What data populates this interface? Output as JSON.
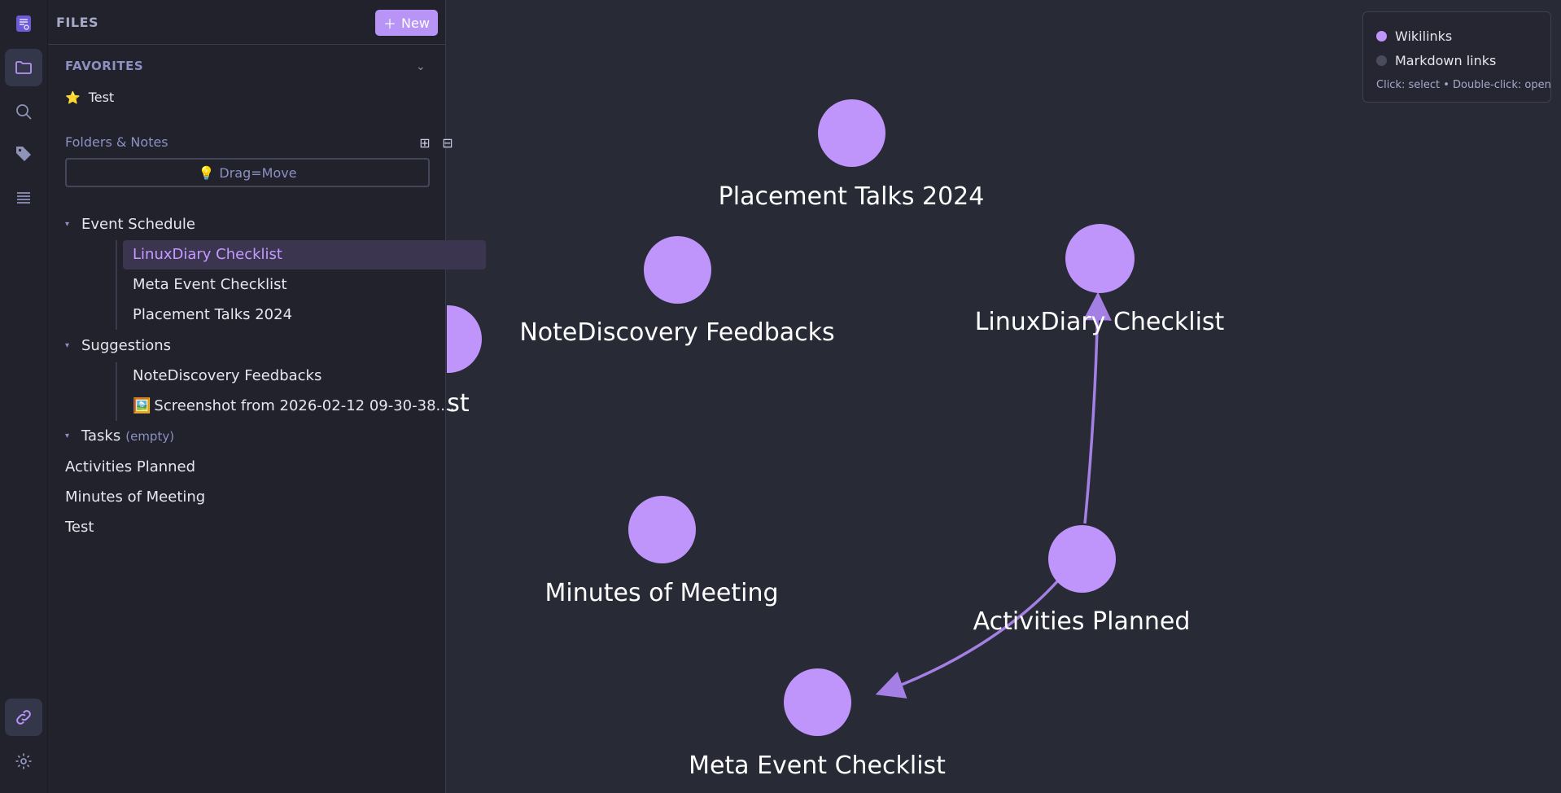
{
  "sidebar": {
    "title": "FILES",
    "new_label": "New",
    "favorites_label": "FAVORITES",
    "favorites": [
      {
        "label": "Test"
      }
    ],
    "folders_label": "Folders & Notes",
    "drag_hint": "Drag=Move",
    "tree": {
      "event_schedule": {
        "label": "Event Schedule",
        "notes": [
          "LinuxDiary Checklist",
          "Meta Event Checklist",
          "Placement Talks 2024"
        ]
      },
      "suggestions": {
        "label": "Suggestions",
        "notes": [
          "NoteDiscovery Feedbacks",
          "Screenshot from 2026-02-12 09-30-38...."
        ]
      },
      "tasks": {
        "label": "Tasks",
        "empty_label": "(empty)"
      },
      "root_notes": [
        "Activities Planned",
        "Minutes of Meeting",
        "Test"
      ]
    }
  },
  "graph": {
    "partial_label": "st",
    "nodes": [
      {
        "label": "Placement Talks 2024"
      },
      {
        "label": "NoteDiscovery Feedbacks"
      },
      {
        "label": "LinuxDiary Checklist"
      },
      {
        "label": "Minutes of Meeting"
      },
      {
        "label": "Activities Planned"
      },
      {
        "label": "Meta Event Checklist"
      }
    ],
    "node_color": "#bf94fb",
    "edge_color": "#a47fe4"
  },
  "legend": {
    "wikilinks_label": "Wikilinks",
    "markdown_label": "Markdown links",
    "hint": "Click: select • Double-click: open",
    "wikilinks_color": "#bf94fb",
    "markdown_color": "#4a4c5e"
  }
}
